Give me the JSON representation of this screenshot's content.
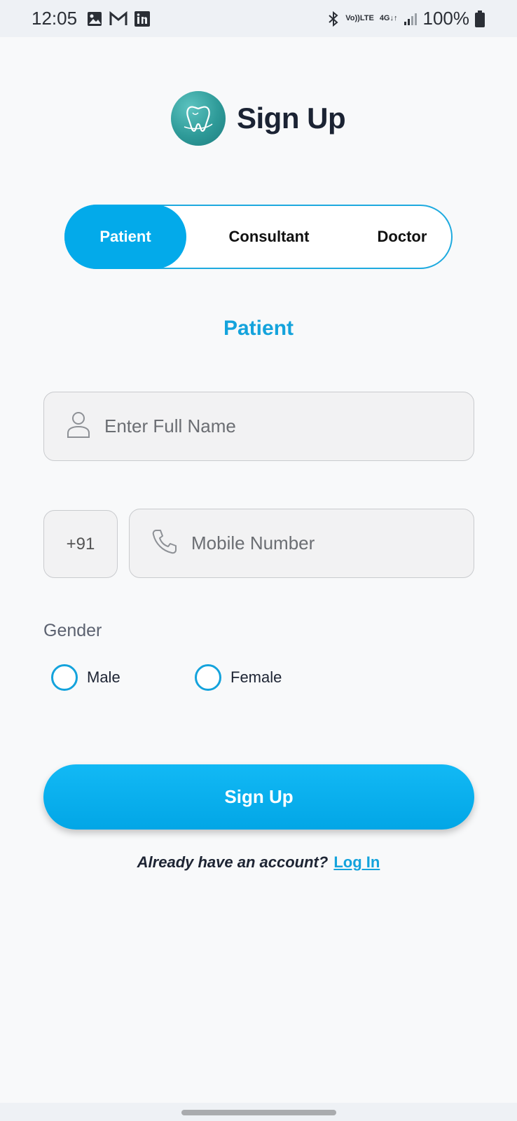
{
  "status_bar": {
    "time": "12:05",
    "left_icons": [
      "gallery-icon",
      "gmail-icon",
      "linkedin-icon"
    ],
    "right_icons": [
      "bluetooth-icon",
      "volte-icon",
      "4g-icon",
      "signal-icon",
      "battery-icon"
    ],
    "volte_top": "Vo))",
    "volte_bottom": "LTE",
    "network_top": "4G",
    "network_bottom": "↓↑",
    "battery": "100%"
  },
  "header": {
    "title": "Sign Up",
    "logo_icon": "tooth-logo-icon"
  },
  "segment": {
    "tabs": [
      {
        "label": "Patient",
        "active": true
      },
      {
        "label": "Consultant",
        "active": false
      },
      {
        "label": "Doctor",
        "active": false
      }
    ]
  },
  "form": {
    "section_title": "Patient",
    "full_name": {
      "placeholder": "Enter Full Name",
      "value": "",
      "icon": "user-icon"
    },
    "country_code": "+91",
    "mobile": {
      "placeholder": "Mobile Number",
      "value": "",
      "icon": "phone-icon"
    },
    "gender_label": "Gender",
    "gender_options": [
      {
        "label": "Male",
        "selected": false
      },
      {
        "label": "Female",
        "selected": false
      }
    ],
    "submit_label": "Sign Up"
  },
  "footer": {
    "prompt": "Already have an account?",
    "link_label": "Log In"
  },
  "colors": {
    "accent": "#03aaea",
    "accent_text": "#14a3dc",
    "background": "#f8f9fa",
    "field_bg": "#f2f2f3",
    "logo": "#2e9a98"
  }
}
